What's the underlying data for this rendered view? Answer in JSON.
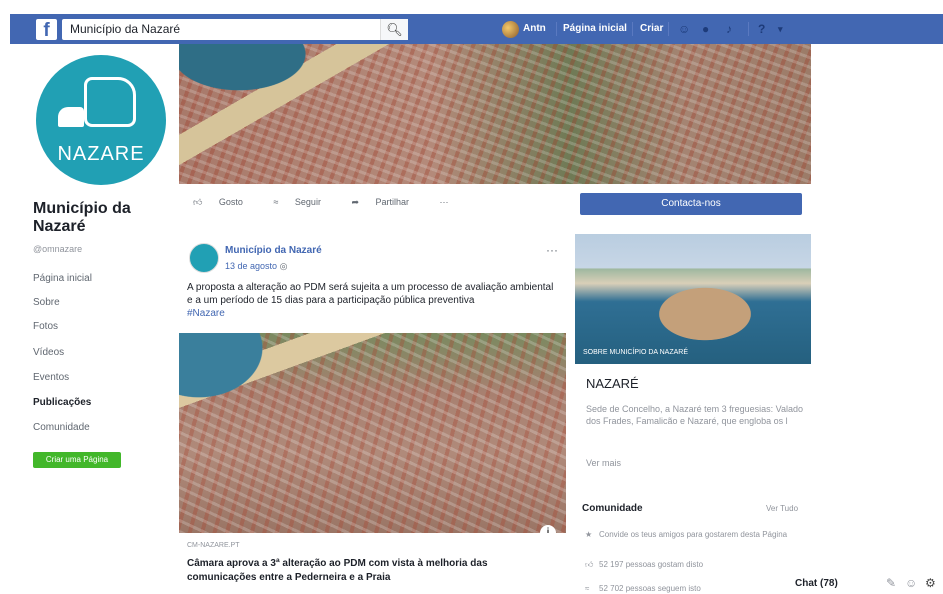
{
  "topbar": {
    "search_value": "Município da Nazaré",
    "user_name": "Antn",
    "home_link": "Página inicial",
    "create_link": "Criar"
  },
  "profile": {
    "logo_text": "NAZARE",
    "name": "Município da Nazaré",
    "handle": "@omnazare"
  },
  "left_nav": {
    "items": [
      "Página inicial",
      "Sobre",
      "Fotos",
      "Vídeos",
      "Eventos",
      "Publicações",
      "Comunidade"
    ],
    "active_index": 5,
    "create_page": "Criar uma Página"
  },
  "actions": {
    "like": "Gosto",
    "follow": "Seguir",
    "share": "Partilhar",
    "more": "···"
  },
  "post": {
    "author": "Município da Nazaré",
    "date": "13 de agosto",
    "text": "A proposta a alteração ao PDM será sujeita a um processo de avaliação ambiental e a um período de 15 dias para a participação pública preventiva",
    "hashtag": "#Nazare",
    "link_domain": "CM-NAZARE.PT",
    "link_title": "Câmara aprova a 3ª alteração ao PDM com vista à melhoria das comunicações entre a Pederneira e a Praia"
  },
  "sidebar": {
    "contact_button": "Contacta-nos",
    "about_caption": "SOBRE MUNICÍPIO DA NAZARÉ",
    "about_title": "NAZARÉ",
    "about_desc": "Sede de Concelho, a Nazaré tem 3 freguesias: Valado dos Frades, Famalicão e Nazaré, que engloba os l",
    "see_more": "Ver mais",
    "community_title": "Comunidade",
    "see_all": "Ver Tudo",
    "invite_text": "Convide os teus amigos para gostarem desta Página",
    "likes_text": "52 197 pessoas gostam disto",
    "follows_text": "52 702 pessoas seguem isto"
  },
  "chat": {
    "label": "Chat (78)"
  }
}
